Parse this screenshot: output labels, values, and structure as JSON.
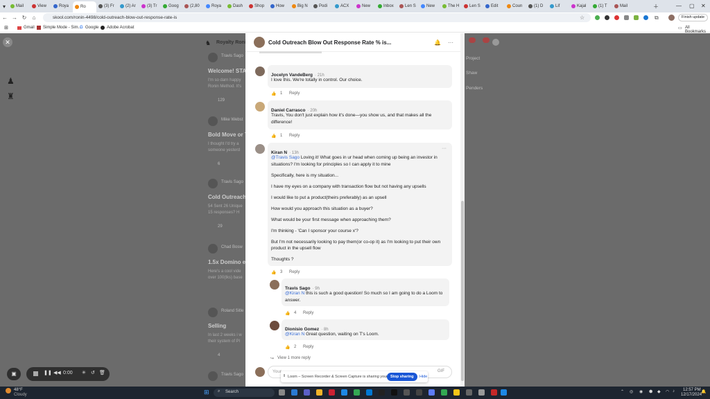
{
  "browser": {
    "tabs": [
      "Mail",
      "View",
      "Roya",
      "Ro",
      "(3) Fr",
      "(2) Ar",
      "(3) Tr",
      "Goog",
      "(2,80",
      "Roya",
      "Dash",
      "Shop",
      "How",
      "Big N",
      "Podi",
      "ACX",
      "New",
      "Inbox",
      "Len S",
      "New",
      "The H",
      "Len S",
      "Edit",
      "Coun",
      "(1) D",
      "Lif",
      "Kajal",
      "(1) T",
      "Mail"
    ],
    "url": "skool.com/ronin-4498/cold-outreach-blow-out-response-rate-is",
    "finish_update": "Finish update",
    "bookmarks": [
      "Gmail",
      "Simple Mode - Sim...",
      "Google",
      "Adobe Acrobat"
    ],
    "all_bookmarks": "All Bookmarks"
  },
  "background": {
    "community": "Royalty Ronin",
    "posts": [
      {
        "author": "Travis Sago",
        "title": "Welcome! STA",
        "excerpt": "I'm so darn happy\nRonin Method. It's",
        "likes": "129"
      },
      {
        "author": "Mike Webst",
        "title": "Bold Move or T",
        "excerpt": "I thought I'd try a\nsomeone yesterd",
        "likes": "6"
      },
      {
        "author": "Travis Sago",
        "title": "Cold Outreach",
        "excerpt": "54 Sent 26 Unique\n15 responses? H",
        "likes": "29"
      },
      {
        "author": "Chad Bosw",
        "title": "1.5x Domino e",
        "excerpt": "Here's a cool vide\nover 100(tks) base",
        "likes": ""
      },
      {
        "author": "Roland Sitle",
        "title": "Selling",
        "excerpt": "In last 2 weeks i w\ntheir system of Pl",
        "likes": "4"
      },
      {
        "author": "Travis Sago",
        "title": "",
        "excerpt": "",
        "likes": ""
      }
    ],
    "right": [
      "Project",
      "Shaw",
      "Penders"
    ]
  },
  "modal": {
    "title": "Cold Outreach Blow Out Response Rate % is...",
    "comments": [
      {
        "name": "Jocelyn VandeBerg",
        "time": "21h",
        "text": "I love this. We're totally in control. Our choice.",
        "likes": "1",
        "reply": "Reply"
      },
      {
        "name": "Daniel Carrasco",
        "time": "20h",
        "text": "Travis, You don't just explain how it's done—you show us, and that makes all the difference!",
        "likes": "1",
        "reply": "Reply"
      },
      {
        "name": "Kiran N",
        "time": "13h",
        "mention": "@Travis Sago",
        "paragraphs": [
          "Loving it! What goes in ur head when coming up being an investor in situations? I'm looking for principles so I can apply it to mine",
          "Specifically, here is my situation...",
          "I have my eyes on a company with transaction flow but not having any upsells",
          "I would like to put a product(theirs preferably) as an upsell",
          "How would you approach this situation as a buyer?",
          "What would be your first message when approaching them?",
          "I'm thinking - 'Can I sponsor your course x'?",
          "But I'm not necessarily looking to pay them(or co-op it) as I'm looking to put their own product in the upsell flow",
          "Thoughts ?"
        ],
        "likes": "3",
        "reply": "Reply"
      }
    ],
    "replies": [
      {
        "name": "Travis Sago",
        "time": "9h",
        "mention": "@Kiran N",
        "text": "this is such a good question! So much so I am going to do a Loom to answer.",
        "likes": "4",
        "reply": "Reply"
      },
      {
        "name": "Dionisio Gomez",
        "time": "8h",
        "mention": "@Kiran N",
        "text": "Great question, waiting on T's Loom.",
        "likes": "2",
        "reply": "Reply"
      }
    ],
    "view_more": "View 1 more reply",
    "input_placeholder": "Your",
    "gif": "GIF"
  },
  "loom": {
    "text": "Loom – Screen Recorder & Screen Capture is sharing your screen.",
    "stop": "Stop sharing",
    "hide": "Hide"
  },
  "recorder": {
    "time": "0:00"
  },
  "taskbar": {
    "weather_temp": "48°F",
    "weather_text": "Cloudy",
    "search": "Search",
    "time": "12:57 PM",
    "date": "12/17/2024"
  }
}
